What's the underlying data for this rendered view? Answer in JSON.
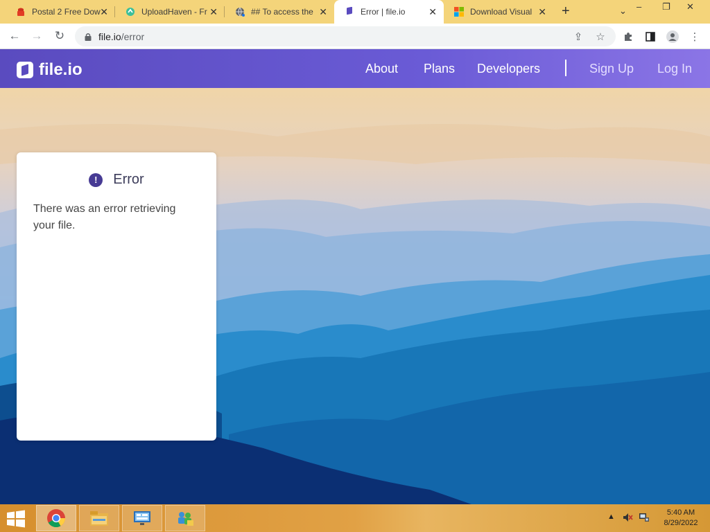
{
  "browser": {
    "tabs": [
      {
        "title": "Postal 2 Free Dow",
        "icon": "postal-favicon",
        "active": false
      },
      {
        "title": "UploadHaven - Fr",
        "icon": "uploadhaven-favicon",
        "active": false
      },
      {
        "title": "## To access the",
        "icon": "globe-favicon",
        "active": false
      },
      {
        "title": "Error | file.io",
        "icon": "fileio-favicon",
        "active": true
      },
      {
        "title": "Download Visual",
        "icon": "microsoft-favicon",
        "active": false
      }
    ],
    "new_tab_label": "+",
    "url_host": "file.io",
    "url_path": "/error"
  },
  "site": {
    "logo_text": "file.io",
    "nav": [
      "About",
      "Plans",
      "Developers"
    ],
    "auth": [
      "Sign Up",
      "Log In"
    ]
  },
  "error_card": {
    "title": "Error",
    "icon_glyph": "!",
    "message": "There was an error retrieving your file."
  },
  "taskbar": {
    "time": "5:40 AM",
    "date": "8/29/2022",
    "pinned": [
      "chrome",
      "file-explorer",
      "control-panel",
      "network-app"
    ]
  },
  "colors": {
    "header_start": "#5a4bbf",
    "header_end": "#8b75e6",
    "error_icon": "#473b94",
    "tab_strip": "#f4d47a"
  }
}
